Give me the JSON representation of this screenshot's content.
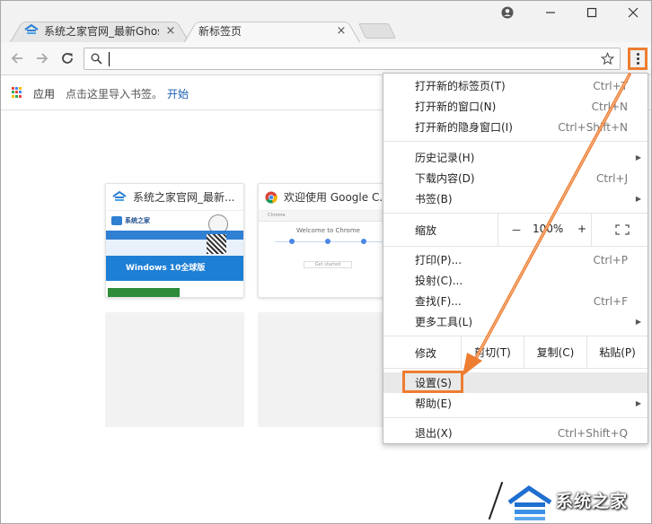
{
  "window": {
    "account_icon": "account-circle-icon",
    "minimize_icon": "minimize-icon",
    "maximize_icon": "maximize-icon",
    "close_icon": "close-icon"
  },
  "tabs": [
    {
      "title": "系统之家官网_最新Ghos",
      "favicon": "xitongzhijia-logo-icon",
      "close": "×",
      "active": false
    },
    {
      "title": "新标签页",
      "close": "×",
      "active": true
    }
  ],
  "toolbar": {
    "back_icon": "arrow-back-icon",
    "forward_icon": "arrow-forward-icon",
    "reload_icon": "reload-icon",
    "search_icon": "search-icon",
    "omnibox_value": "",
    "star_icon": "bookmark-star-icon",
    "menu_icon": "kebab-menu-icon"
  },
  "bookmarks": {
    "apps_label": "应用",
    "hint": "点击这里导入书签。",
    "start_link": "开始"
  },
  "tiles": [
    {
      "title": "系统之家官网_最新...",
      "thumb_text": "Windows 10全球版",
      "logo_text": "系统之家"
    },
    {
      "title": "欢迎使用 Google C...",
      "thumb_text": "Welcome to Chrome",
      "thumb_bar": "Chrome",
      "thumb_button": "Get started"
    }
  ],
  "menu": {
    "items_top": [
      {
        "label": "打开新的标签页(T)",
        "shortcut": "Ctrl+T"
      },
      {
        "label": "打开新的窗口(N)",
        "shortcut": "Ctrl+N"
      },
      {
        "label": "打开新的隐身窗口(I)",
        "shortcut": "Ctrl+Shift+N"
      }
    ],
    "items_history": [
      {
        "label": "历史记录(H)",
        "shortcut": "",
        "submenu": true
      },
      {
        "label": "下载内容(D)",
        "shortcut": "Ctrl+J",
        "submenu": false
      },
      {
        "label": "书签(B)",
        "shortcut": "",
        "submenu": true
      }
    ],
    "zoom": {
      "label": "缩放",
      "minus": "－",
      "value": "100%",
      "plus": "+"
    },
    "items_tools": [
      {
        "label": "打印(P)...",
        "shortcut": "Ctrl+P",
        "submenu": false
      },
      {
        "label": "投射(C)...",
        "shortcut": "",
        "submenu": false
      },
      {
        "label": "查找(F)...",
        "shortcut": "Ctrl+F",
        "submenu": false
      },
      {
        "label": "更多工具(L)",
        "shortcut": "",
        "submenu": true
      }
    ],
    "edit": {
      "label": "修改",
      "cut": "剪切(T)",
      "copy": "复制(C)",
      "paste": "粘贴(P)"
    },
    "settings": {
      "label": "设置(S)"
    },
    "help": {
      "label": "帮助(E)"
    },
    "exit": {
      "label": "退出(X)",
      "shortcut": "Ctrl+Shift+Q"
    }
  },
  "watermark": {
    "text": "系统之家"
  },
  "colors": {
    "highlight": "#ed7d31",
    "link": "#1a5fb4"
  }
}
